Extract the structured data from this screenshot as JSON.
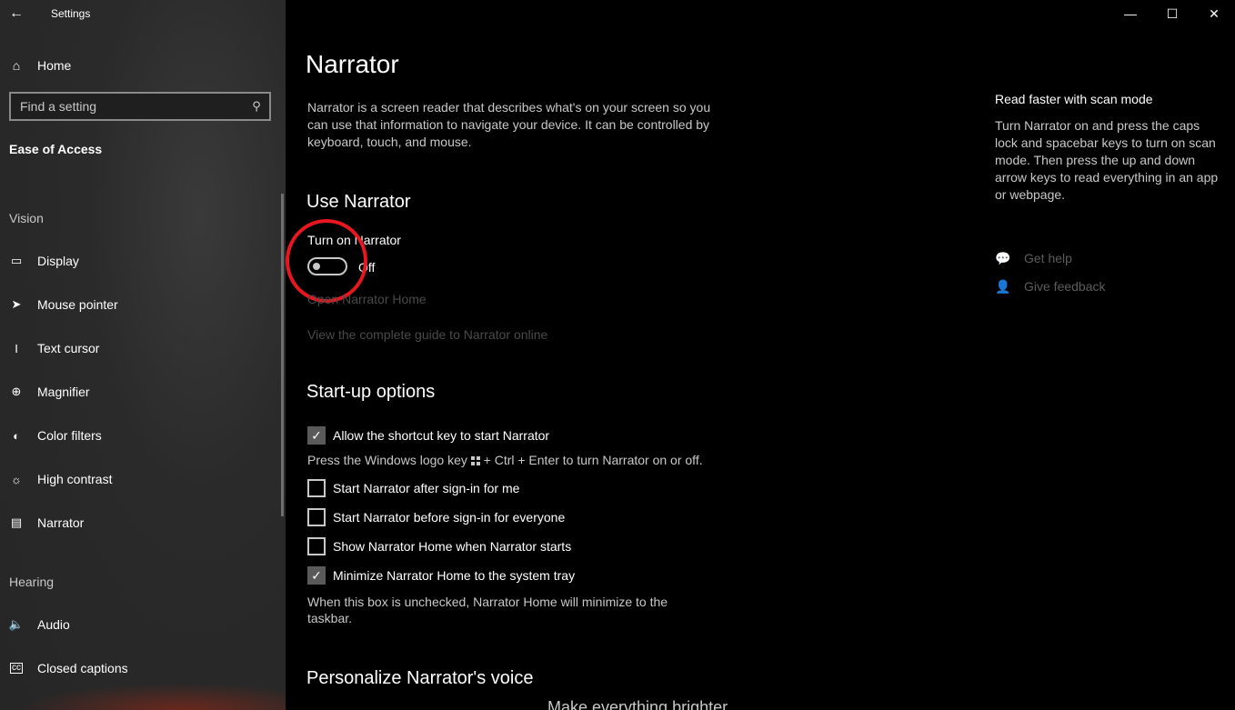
{
  "window": {
    "title": "Settings"
  },
  "sidebar": {
    "home_label": "Home",
    "search_placeholder": "Find a setting",
    "section_title": "Ease of Access",
    "vision_label": "Vision",
    "vision_items": [
      {
        "label": "Display",
        "icon": "monitor-icon"
      },
      {
        "label": "Mouse pointer",
        "icon": "mouse-pointer-icon"
      },
      {
        "label": "Text cursor",
        "icon": "text-cursor-icon"
      },
      {
        "label": "Magnifier",
        "icon": "magnifier-icon"
      },
      {
        "label": "Color filters",
        "icon": "color-filters-icon"
      },
      {
        "label": "High contrast",
        "icon": "high-contrast-icon"
      },
      {
        "label": "Narrator",
        "icon": "narrator-icon"
      }
    ],
    "hearing_label": "Hearing",
    "hearing_items": [
      {
        "label": "Audio",
        "icon": "audio-icon"
      },
      {
        "label": "Closed captions",
        "icon": "closed-captions-icon"
      }
    ]
  },
  "main": {
    "title": "Narrator",
    "description": "Narrator is a screen reader that describes what's on your screen so you can use that information to navigate your device. It can be controlled by keyboard, touch, and mouse.",
    "use_narrator": {
      "heading": "Use Narrator",
      "toggle_label": "Turn on Narrator",
      "toggle_state": "Off",
      "open_home_link": "Open Narrator Home",
      "guide_link": "View the complete guide to Narrator online"
    },
    "startup": {
      "heading": "Start-up options",
      "shortcut_label": "Allow the shortcut key to start Narrator",
      "shortcut_checked": true,
      "shortcut_help_pre": "Press the Windows logo key",
      "shortcut_help_post": "+ Ctrl + Enter to turn Narrator on or off.",
      "after_signin_label": "Start Narrator after sign-in for me",
      "before_signin_label": "Start Narrator before sign-in for everyone",
      "show_home_label": "Show Narrator Home when Narrator starts",
      "minimize_label": "Minimize Narrator Home to the system tray",
      "minimize_checked": true,
      "minimize_help": "When this box is unchecked, Narrator Home will minimize to the taskbar."
    },
    "voice_heading": "Personalize Narrator's voice",
    "cut_text": "Make everything brighter"
  },
  "aside": {
    "title": "Read faster with scan mode",
    "description": "Turn Narrator on and press the caps lock and spacebar keys to turn on scan mode. Then press the up and down arrow keys to read everything in an app or webpage.",
    "get_help": "Get help",
    "give_feedback": "Give feedback"
  },
  "colors": {
    "annotation_circle": "#e8161e",
    "background": "#000000",
    "sidebar": "#2b2b2b"
  }
}
